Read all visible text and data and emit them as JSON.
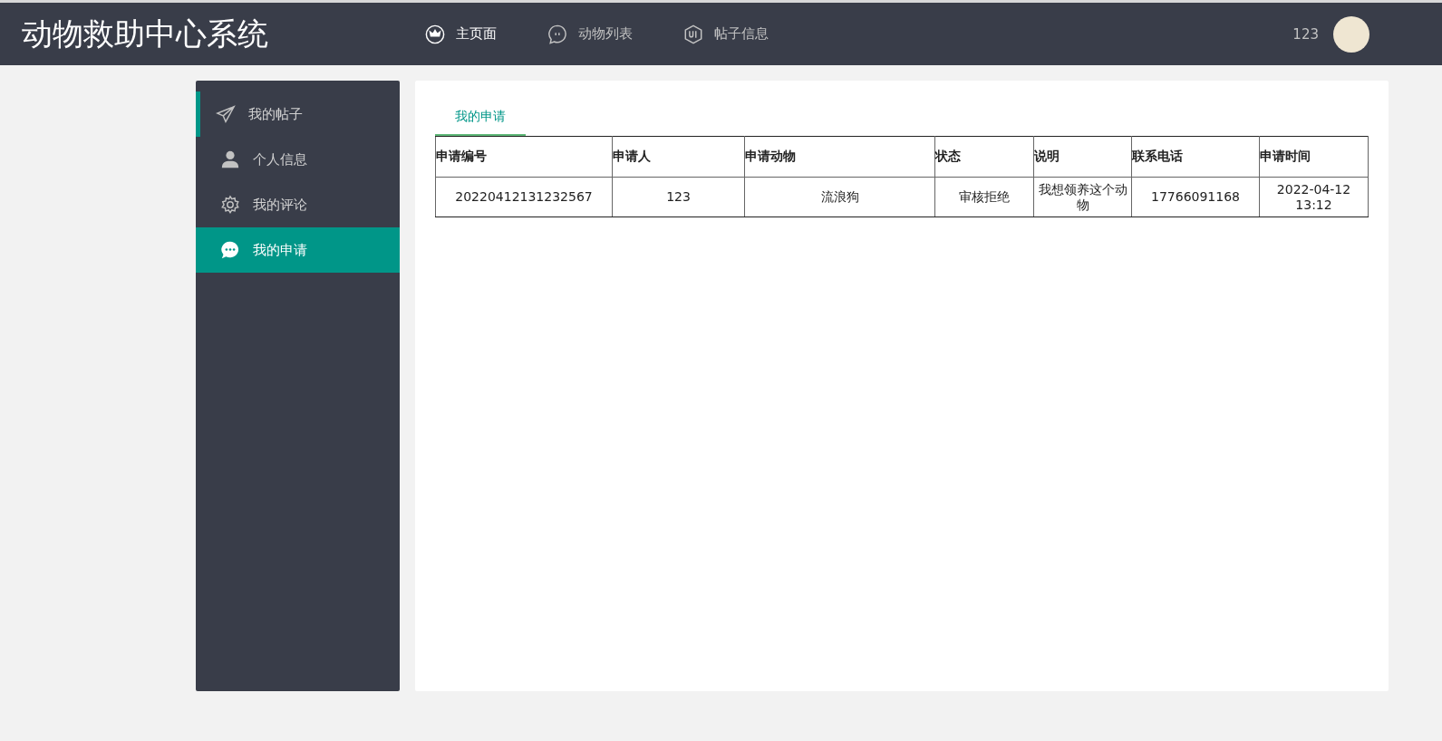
{
  "header": {
    "title": "动物救助中心系统",
    "nav": [
      {
        "label": "主页面",
        "selected": true
      },
      {
        "label": "动物列表",
        "selected": false
      },
      {
        "label": "帖子信息",
        "selected": false
      }
    ],
    "username": "123"
  },
  "sidebar": {
    "items": [
      {
        "label": "我的帖子",
        "selected": false,
        "hover": true
      },
      {
        "label": "个人信息",
        "selected": false,
        "hover": false
      },
      {
        "label": "我的评论",
        "selected": false,
        "hover": false
      },
      {
        "label": "我的申请",
        "selected": true,
        "hover": false
      }
    ]
  },
  "tabs": [
    {
      "label": "我的申请",
      "selected": true
    }
  ],
  "table": {
    "columns": [
      "申请编号",
      "申请人",
      "申请动物",
      "状态",
      "说明",
      "联系电话",
      "申请时间"
    ],
    "rows": [
      [
        "20220412131232567",
        "123",
        "流浪狗",
        "审核拒绝",
        "我想领养这个动物",
        "17766091168",
        "2022-04-12 13:12"
      ]
    ]
  }
}
